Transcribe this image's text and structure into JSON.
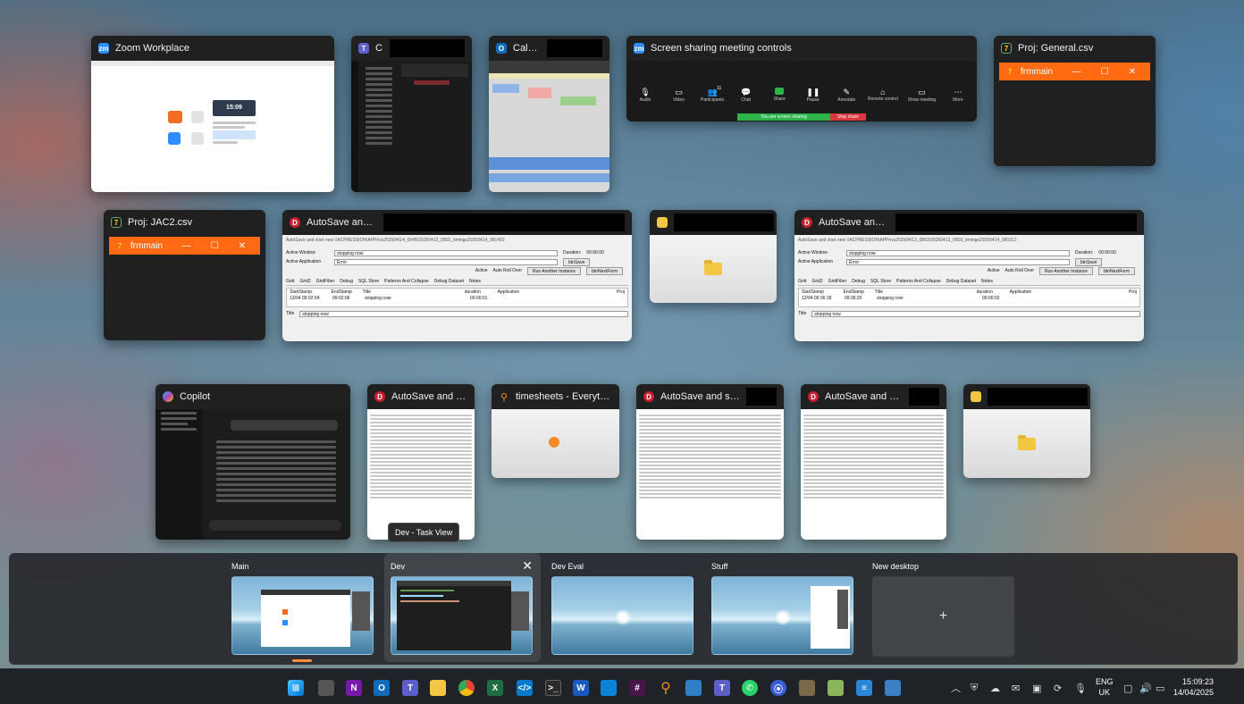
{
  "windows": {
    "zoom": {
      "title": "Zoom Workplace",
      "meeting_time": "15:09"
    },
    "chat": {
      "title": "Chat"
    },
    "calendar": {
      "title": "Calendar"
    },
    "screen_share": {
      "title": "Screen sharing meeting controls",
      "controls": [
        "Audio",
        "Video",
        "Participants",
        "Chat",
        "Share",
        "Pause",
        "Annotate",
        "Remote control",
        "Show meeting",
        "More"
      ],
      "participants_count": "11",
      "status_share": "You are screen sharing",
      "stop_share": "Stop share"
    },
    "proj_general": {
      "title": "Proj: General.csv",
      "inner": "frmmain"
    },
    "proj_jac2": {
      "title": "Proj: JAC2.csv",
      "inner": "frmmain"
    },
    "autosave1": {
      "title": "AutoSave and start new",
      "path": "AutoSave and start new \\\\ACPRESSION\\APPrivs202504\\14_0045\\20250413_0802_timings20250414_081402",
      "active_window_label": "Active Window",
      "active_window_value": "stopping now",
      "active_app_label": "Active Application",
      "active_app_value": "Error",
      "duration_label": "Duration:",
      "duration_value": "00:00:00",
      "btn_save": "btnSave",
      "btn_next": "btnNextForm",
      "chk_active": "Active",
      "chk_autoroll": "Auto Roll Over",
      "btn_another": "Run Another Instance",
      "tabs": [
        "Grid",
        "Grid2",
        "GridFilter",
        "Debug",
        "SQL Store",
        "Patterns And Collapse",
        "Debug Dataset",
        "Notes"
      ],
      "cols": [
        "StartStamp",
        "EndStamp",
        "Title",
        "duration",
        "Application",
        "Proj"
      ],
      "row": [
        "13/04 09:02:04",
        "09:02:06",
        "stopping now",
        "00:00:01"
      ],
      "title_label": "Title",
      "title_value": "stopping now"
    },
    "autosave2": {
      "title": "AutoSave and start new",
      "path": "AutoSave and start new \\\\ACPRESSION\\APPrivs202504\\13_0803\\20250413_0803_timings20250414_081012",
      "active_window_label": "Active Window",
      "active_window_value": "stopping now",
      "active_app_label": "Active Application",
      "active_app_value": "Error",
      "duration_label": "Duration:",
      "duration_value": "00:00:00",
      "btn_save": "btnSave",
      "btn_next": "btnNextForm",
      "chk_active": "Active",
      "chk_autoroll": "Auto Roll Over",
      "btn_another": "Run Another Instance",
      "tabs": [
        "Grid",
        "Grid2",
        "GridFilter",
        "Debug",
        "SQL Store",
        "Patterns And Collapse",
        "Debug Dataset",
        "Notes"
      ],
      "cols": [
        "StartStamp",
        "EndStamp",
        "Title",
        "duration",
        "Application",
        "Proj"
      ],
      "row": [
        "12/04 09:36:18",
        "09:36:20",
        "stopping now",
        "00:00:02"
      ],
      "title_label": "Title",
      "title_value": "stopping now"
    },
    "copilot": {
      "title": "Copilot"
    },
    "autosave3": {
      "title": "AutoSave and start..."
    },
    "timesheets": {
      "title": "timesheets - Everything"
    },
    "autosave4": {
      "title": "AutoSave and start new"
    },
    "autosave5": {
      "title": "AutoSave and start new"
    }
  },
  "tooltip": "Dev - Task View",
  "desktops": [
    {
      "label": "Main"
    },
    {
      "label": "Dev"
    },
    {
      "label": "Dev Eval"
    },
    {
      "label": "Stuff"
    },
    {
      "label": "New desktop"
    }
  ],
  "new_desktop_plus": "+",
  "tray": {
    "lang_top": "ENG",
    "lang_bottom": "UK",
    "time": "15:09:23",
    "date": "14/04/2025"
  },
  "colors": {
    "accent": "#ff6a13",
    "share_green": "#2db34a",
    "stop_red": "#d9363e",
    "zoom_blue": "#2d8cff"
  }
}
